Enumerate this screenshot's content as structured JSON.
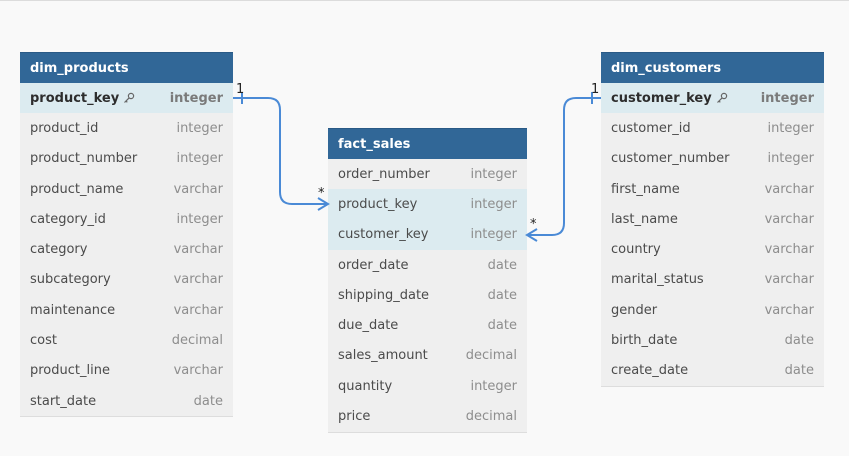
{
  "colors": {
    "header": "#316797",
    "highlight": "#dcebf0",
    "relation": "#4a8ad6"
  },
  "tables": {
    "dim_products": {
      "title": "dim_products",
      "fields": [
        {
          "name": "product_key",
          "type": "integer",
          "pk": true
        },
        {
          "name": "product_id",
          "type": "integer"
        },
        {
          "name": "product_number",
          "type": "integer"
        },
        {
          "name": "product_name",
          "type": "varchar"
        },
        {
          "name": "category_id",
          "type": "integer"
        },
        {
          "name": "category",
          "type": "varchar"
        },
        {
          "name": "subcategory",
          "type": "varchar"
        },
        {
          "name": "maintenance",
          "type": "varchar"
        },
        {
          "name": "cost",
          "type": "decimal"
        },
        {
          "name": "product_line",
          "type": "varchar"
        },
        {
          "name": "start_date",
          "type": "date"
        }
      ]
    },
    "fact_sales": {
      "title": "fact_sales",
      "fields": [
        {
          "name": "order_number",
          "type": "integer"
        },
        {
          "name": "product_key",
          "type": "integer",
          "fk": true
        },
        {
          "name": "customer_key",
          "type": "integer",
          "fk": true
        },
        {
          "name": "order_date",
          "type": "date"
        },
        {
          "name": "shipping_date",
          "type": "date"
        },
        {
          "name": "due_date",
          "type": "date"
        },
        {
          "name": "sales_amount",
          "type": "decimal"
        },
        {
          "name": "quantity",
          "type": "integer"
        },
        {
          "name": "price",
          "type": "decimal"
        }
      ]
    },
    "dim_customers": {
      "title": "dim_customers",
      "fields": [
        {
          "name": "customer_key",
          "type": "integer",
          "pk": true
        },
        {
          "name": "customer_id",
          "type": "integer"
        },
        {
          "name": "customer_number",
          "type": "integer"
        },
        {
          "name": "first_name",
          "type": "varchar"
        },
        {
          "name": "last_name",
          "type": "varchar"
        },
        {
          "name": "country",
          "type": "varchar"
        },
        {
          "name": "marital_status",
          "type": "varchar"
        },
        {
          "name": "gender",
          "type": "varchar"
        },
        {
          "name": "birth_date",
          "type": "date"
        },
        {
          "name": "create_date",
          "type": "date"
        }
      ]
    }
  },
  "relations": [
    {
      "from": "dim_products.product_key",
      "to": "fact_sales.product_key",
      "from_card": "1",
      "to_card": "*"
    },
    {
      "from": "dim_customers.customer_key",
      "to": "fact_sales.customer_key",
      "from_card": "1",
      "to_card": "*"
    }
  ]
}
